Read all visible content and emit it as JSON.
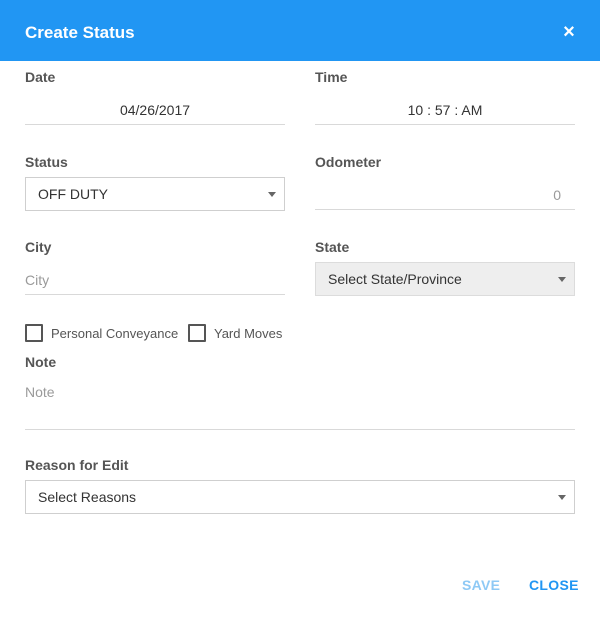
{
  "dialog": {
    "title": "Create Status",
    "close_icon": "×"
  },
  "date": {
    "label": "Date",
    "value": "04/26/2017"
  },
  "time": {
    "label": "Time",
    "value": "10 : 57 : AM"
  },
  "status": {
    "label": "Status",
    "value": "OFF DUTY"
  },
  "odometer": {
    "label": "Odometer",
    "value": "0"
  },
  "city": {
    "label": "City",
    "placeholder": "City"
  },
  "state": {
    "label": "State",
    "value": "Select State/Province"
  },
  "checks": {
    "personal_conveyance": "Personal Conveyance",
    "yard_moves": "Yard Moves"
  },
  "note": {
    "label": "Note",
    "placeholder": "Note"
  },
  "reason": {
    "label": "Reason for Edit",
    "value": "Select Reasons"
  },
  "actions": {
    "save_label": "SAVE",
    "close_label": "CLOSE"
  },
  "colors": {
    "accent": "#2196f3",
    "save_disabled": "#8ec9f5"
  }
}
